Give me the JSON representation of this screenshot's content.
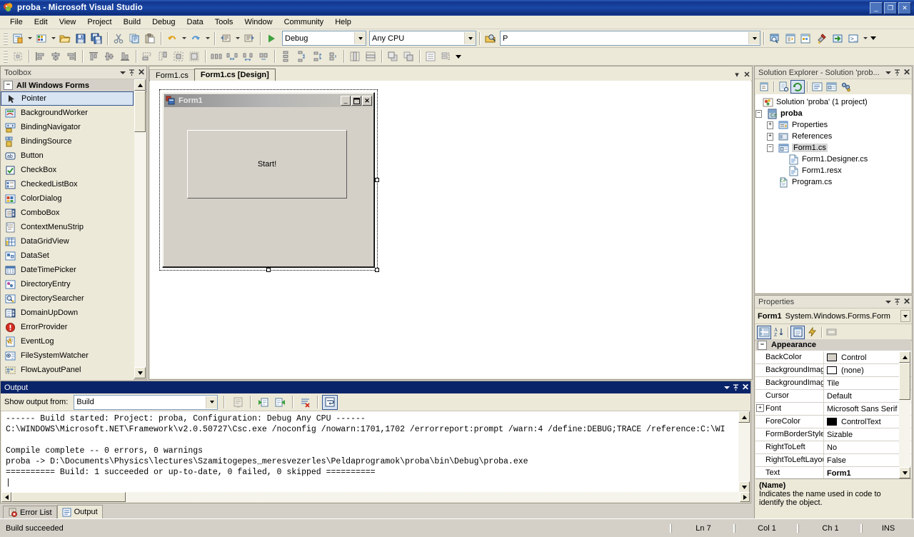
{
  "window": {
    "title": "proba - Microsoft Visual Studio",
    "icon": "vs-logo-icon",
    "buttons": {
      "minimize": "_",
      "restore": "❐",
      "close": "✕"
    }
  },
  "menu": {
    "items": [
      "File",
      "Edit",
      "View",
      "Project",
      "Build",
      "Debug",
      "Data",
      "Tools",
      "Window",
      "Community",
      "Help"
    ]
  },
  "toolbar_standard": {
    "new_project": "new-project-icon",
    "add_item": "add-new-item-icon",
    "open": "open-file-icon",
    "save": "save-icon",
    "save_all": "save-all-icon",
    "cut": "cut-icon",
    "copy": "copy-icon",
    "paste": "paste-icon",
    "undo": "undo-icon",
    "redo": "redo-icon",
    "comment": "comment-icon",
    "uncomment": "uncomment-icon",
    "start": "start-debug-icon",
    "configuration": "Debug",
    "platform": "Any CPU",
    "find_target_icon": "find-in-files-icon",
    "find_value": "P",
    "solution_explorer": "solution-explorer-icon",
    "properties_window": "properties-window-icon",
    "object_browser": "object-browser-icon",
    "toolbox_btn": "toolbox-icon",
    "start_page": "start-page-icon",
    "command_window": "command-window-icon",
    "overflow": "toolbar-overflow-icon"
  },
  "toolbar_layout": {
    "overflow": "toolbar-overflow-icon"
  },
  "toolbox": {
    "title": "Toolbox",
    "group": "All Windows Forms",
    "group_expander": "−",
    "items": [
      {
        "label": "Pointer",
        "icon": "pointer-icon",
        "selected": true
      },
      {
        "label": "BackgroundWorker",
        "icon": "backgroundworker-icon",
        "selected": false
      },
      {
        "label": "BindingNavigator",
        "icon": "bindingnavigator-icon",
        "selected": false
      },
      {
        "label": "BindingSource",
        "icon": "bindingsource-icon",
        "selected": false
      },
      {
        "label": "Button",
        "icon": "button-icon",
        "selected": false
      },
      {
        "label": "CheckBox",
        "icon": "checkbox-icon",
        "selected": false
      },
      {
        "label": "CheckedListBox",
        "icon": "checkedlistbox-icon",
        "selected": false
      },
      {
        "label": "ColorDialog",
        "icon": "colordialog-icon",
        "selected": false
      },
      {
        "label": "ComboBox",
        "icon": "combobox-icon",
        "selected": false
      },
      {
        "label": "ContextMenuStrip",
        "icon": "contextmenustrip-icon",
        "selected": false
      },
      {
        "label": "DataGridView",
        "icon": "datagridview-icon",
        "selected": false
      },
      {
        "label": "DataSet",
        "icon": "dataset-icon",
        "selected": false
      },
      {
        "label": "DateTimePicker",
        "icon": "datetimepicker-icon",
        "selected": false
      },
      {
        "label": "DirectoryEntry",
        "icon": "directoryentry-icon",
        "selected": false
      },
      {
        "label": "DirectorySearcher",
        "icon": "directorysearcher-icon",
        "selected": false
      },
      {
        "label": "DomainUpDown",
        "icon": "domainupdown-icon",
        "selected": false
      },
      {
        "label": "ErrorProvider",
        "icon": "errorprovider-icon",
        "selected": false
      },
      {
        "label": "EventLog",
        "icon": "eventlog-icon",
        "selected": false
      },
      {
        "label": "FileSystemWatcher",
        "icon": "filesystemwatcher-icon",
        "selected": false
      },
      {
        "label": "FlowLayoutPanel",
        "icon": "flowlayoutpanel-icon",
        "selected": false
      }
    ]
  },
  "designer": {
    "tabs": [
      {
        "label": "Form1.cs",
        "active": false
      },
      {
        "label": "Form1.cs [Design]",
        "active": true
      }
    ],
    "form": {
      "icon": "form-icon",
      "title": "Form1",
      "minimize": "_",
      "maximize": "❐",
      "close": "✕",
      "button_text": "Start!"
    }
  },
  "solution_explorer": {
    "title": "Solution Explorer - Solution 'prob...",
    "toolbar": [
      "properties-icon",
      "show-all-files-icon",
      "refresh-icon",
      "view-code-icon",
      "view-designer-icon",
      "class-view-icon"
    ],
    "tree": [
      {
        "label": "Solution 'proba' (1 project)",
        "indent": 0,
        "expander": "",
        "icon": "solution-icon",
        "bold": false,
        "selected": false
      },
      {
        "label": "proba",
        "indent": 1,
        "expander": "−",
        "icon": "csharp-project-icon",
        "bold": true,
        "selected": false
      },
      {
        "label": "Properties",
        "indent": 2,
        "expander": "+",
        "icon": "properties-folder-icon",
        "bold": false,
        "selected": false
      },
      {
        "label": "References",
        "indent": 2,
        "expander": "+",
        "icon": "references-icon",
        "bold": false,
        "selected": false
      },
      {
        "label": "Form1.cs",
        "indent": 2,
        "expander": "−",
        "icon": "form-file-icon",
        "bold": false,
        "selected": true
      },
      {
        "label": "Form1.Designer.cs",
        "indent": 3,
        "expander": "",
        "icon": "cs-file-icon",
        "bold": false,
        "selected": false
      },
      {
        "label": "Form1.resx",
        "indent": 3,
        "expander": "",
        "icon": "cs-file-icon",
        "bold": false,
        "selected": false
      },
      {
        "label": "Program.cs",
        "indent": 2,
        "expander": "",
        "icon": "csharp-file-icon",
        "bold": false,
        "selected": false
      }
    ]
  },
  "properties": {
    "title": "Properties",
    "object_name": "Form1",
    "object_type": "System.Windows.Forms.Form",
    "toolbar": [
      "categorized-icon",
      "alphabetical-icon",
      "properties-page-icon",
      "events-icon",
      "property-pages-icon"
    ],
    "category": "Appearance",
    "category_expander": "−",
    "rows": [
      {
        "name": "BackColor",
        "value": "Control",
        "swatch": "#d4d0c8",
        "expander": "",
        "bold": false
      },
      {
        "name": "BackgroundImage",
        "value": "(none)",
        "swatch": "#ffffff",
        "expander": "",
        "bold": false
      },
      {
        "name": "BackgroundImageL",
        "value": "Tile",
        "swatch": "",
        "expander": "",
        "bold": false
      },
      {
        "name": "Cursor",
        "value": "Default",
        "swatch": "",
        "expander": "",
        "bold": false
      },
      {
        "name": "Font",
        "value": "Microsoft Sans Serif",
        "swatch": "",
        "expander": "+",
        "bold": false
      },
      {
        "name": "ForeColor",
        "value": "ControlText",
        "swatch": "#000000",
        "expander": "",
        "bold": false
      },
      {
        "name": "FormBorderStyle",
        "value": "Sizable",
        "swatch": "",
        "expander": "",
        "bold": false
      },
      {
        "name": "RightToLeft",
        "value": "No",
        "swatch": "",
        "expander": "",
        "bold": false
      },
      {
        "name": "RightToLeftLayout",
        "value": "False",
        "swatch": "",
        "expander": "",
        "bold": false
      },
      {
        "name": "Text",
        "value": "Form1",
        "swatch": "",
        "expander": "",
        "bold": true
      }
    ],
    "description": {
      "title": "(Name)",
      "text": "Indicates the name used in code to identify the object."
    }
  },
  "output": {
    "title": "Output",
    "show_output_from_label": "Show output from:",
    "show_output_from_value": "Build",
    "toolbar": [
      "find-message-icon",
      "go-to-previous-icon",
      "go-to-next-icon",
      "clear-all-icon",
      "toggle-word-wrap-icon"
    ],
    "lines": [
      "------ Build started: Project: proba, Configuration: Debug Any CPU ------",
      "C:\\WINDOWS\\Microsoft.NET\\Framework\\v2.0.50727\\Csc.exe /noconfig /nowarn:1701,1702 /errorreport:prompt /warn:4 /define:DEBUG;TRACE /reference:C:\\WI",
      "",
      "Compile complete -- 0 errors, 0 warnings",
      "proba -> D:\\Documents\\Physics\\lectures\\Szamitogepes_meresvezerles\\Peldaprogramok\\proba\\bin\\Debug\\proba.exe",
      "========== Build: 1 succeeded or up-to-date, 0 failed, 0 skipped ==========",
      "|"
    ]
  },
  "bottom_tabs": [
    {
      "label": "Error List",
      "icon": "error-list-icon",
      "active": false
    },
    {
      "label": "Output",
      "icon": "output-icon",
      "active": true
    }
  ],
  "statusbar": {
    "message": "Build succeeded",
    "line": "Ln 7",
    "col": "Col 1",
    "ch": "Ch 1",
    "insert_mode": "INS"
  },
  "colors": {
    "title_blue": "#14368f",
    "panel_face": "#ece9d8",
    "chrome": "#d4d0c8",
    "selection": "#d8e4f2",
    "output_title": "#0a246a"
  }
}
